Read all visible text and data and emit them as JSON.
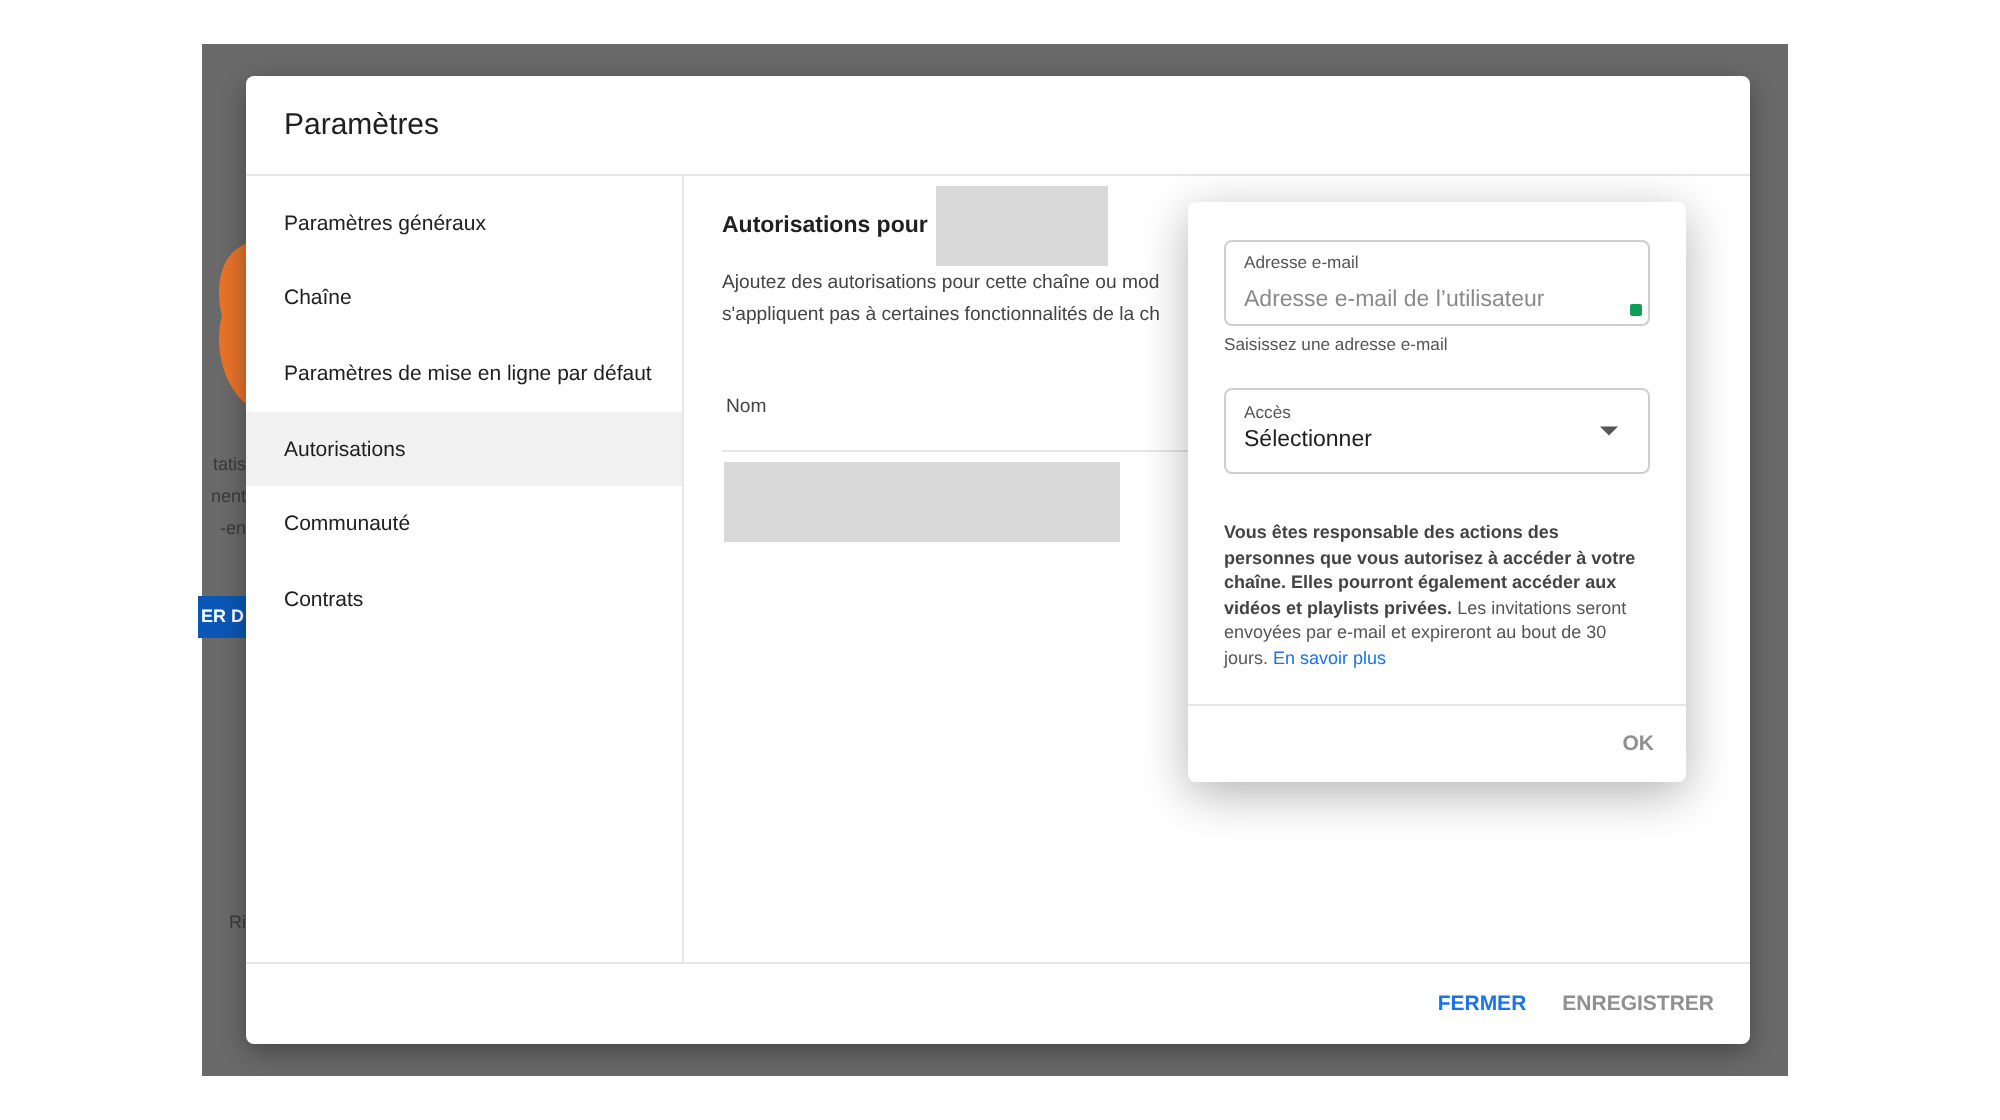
{
  "backdrop": {
    "fragments": [
      "tatis",
      "nent",
      "-en"
    ],
    "button": "ER D",
    "bottom_fragment": "Ri"
  },
  "dialog": {
    "title": "Paramètres",
    "sidebar": {
      "items": [
        {
          "label": "Paramètres généraux",
          "selected": false
        },
        {
          "label": "Chaîne",
          "selected": false
        },
        {
          "label": "Paramètres de mise en ligne par défaut",
          "selected": false
        },
        {
          "label": "Autorisations",
          "selected": true
        },
        {
          "label": "Communauté",
          "selected": false
        },
        {
          "label": "Contrats",
          "selected": false
        }
      ]
    },
    "content": {
      "heading": "Autorisations pour",
      "description": [
        "Ajoutez des autorisations pour cette chaîne ou mod",
        "s'appliquent pas à certaines fonctionnalités de la ch"
      ],
      "table": {
        "columns": [
          "Nom"
        ]
      }
    },
    "footer": {
      "buttons": [
        {
          "label": "FERMER",
          "disabled": false
        },
        {
          "label": "ENREGISTRER",
          "disabled": true
        }
      ]
    }
  },
  "popup": {
    "email_field": {
      "label": "Adresse e-mail",
      "placeholder": "Adresse e-mail de l’utilisateur",
      "helper": "Saisissez une adresse e-mail"
    },
    "access_select": {
      "label": "Accès",
      "value": "Sélectionner"
    },
    "notice": "**Vous êtes responsable des actions des personnes que vous autorisez à accéder à votre chaîne. Elles pourront également accéder aux vidéos et playlists privées.** Les invitations seront envoyées par e-mail et expireront au bout de 30 jours.",
    "link": "En savoir plus",
    "buttons": [
      {
        "label": "OK",
        "disabled": true
      }
    ]
  }
}
